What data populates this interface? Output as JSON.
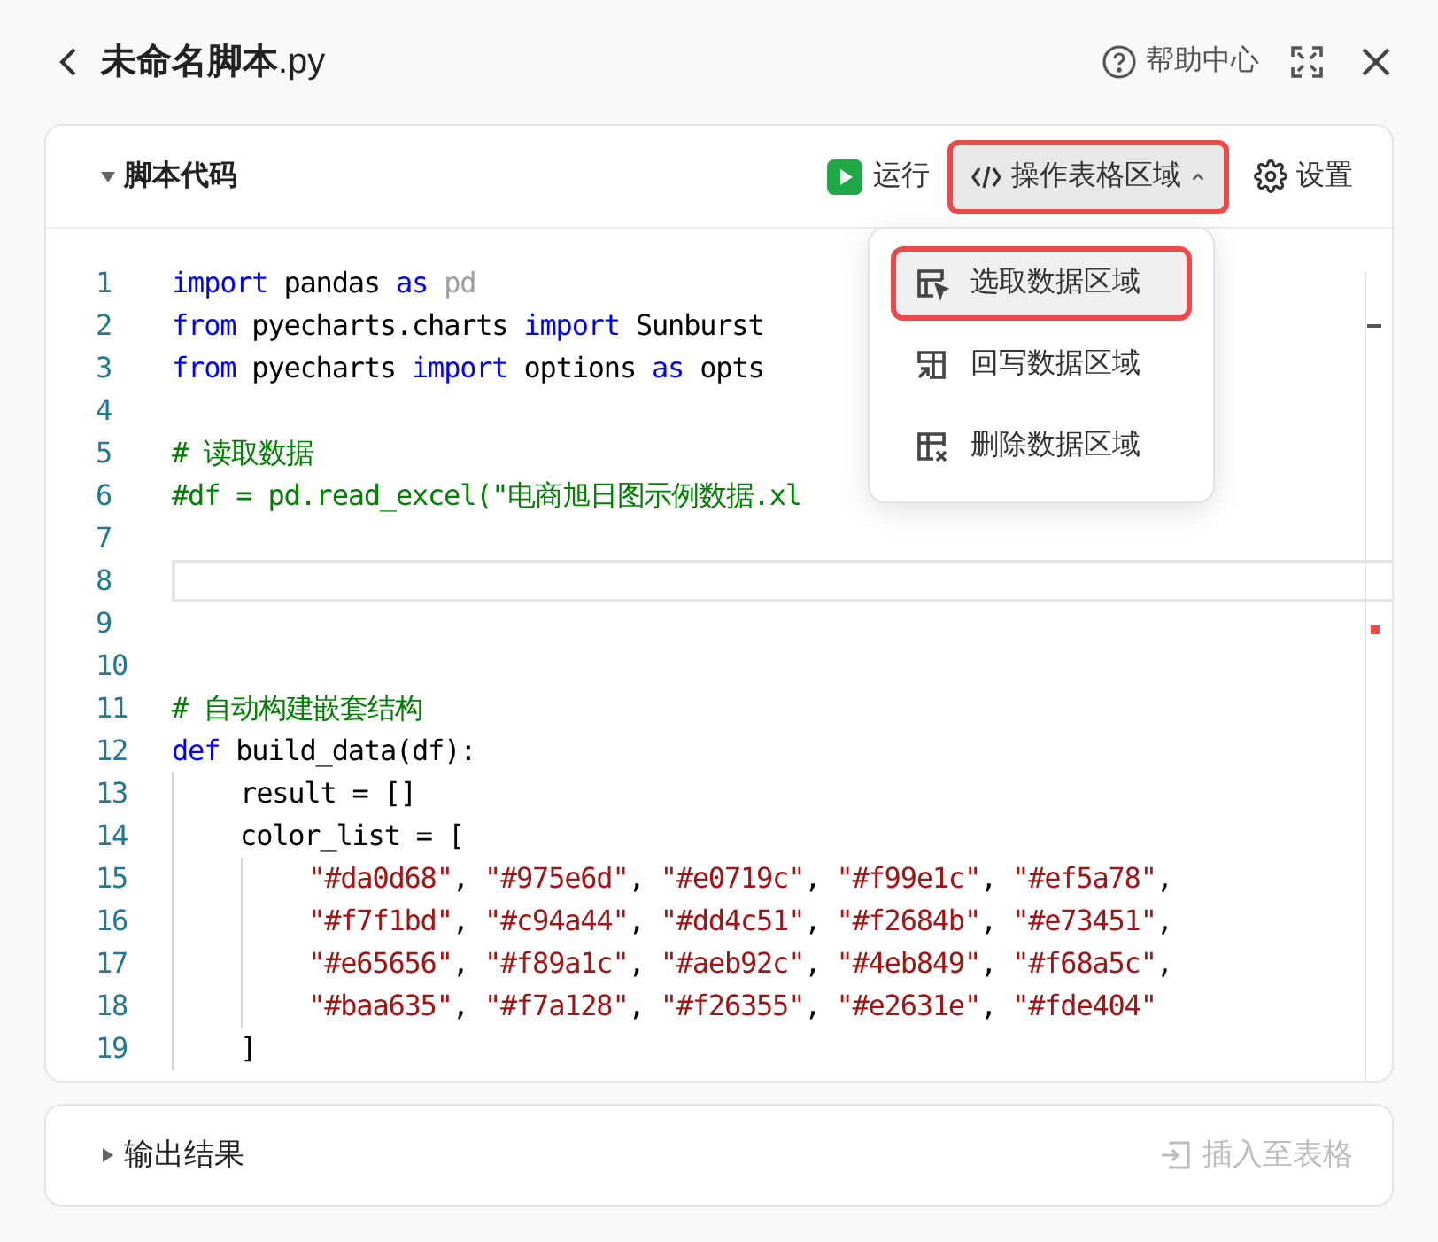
{
  "header": {
    "title_bold": "未命名脚本",
    "title_ext": ".py",
    "help": "帮助中心"
  },
  "script_panel": {
    "title": "脚本代码",
    "expanded": true,
    "run": "运行",
    "operate": {
      "label": "操作表格区域",
      "expanded": true
    },
    "settings": "设置",
    "menu": [
      {
        "label": "选取数据区域",
        "selected": true
      },
      {
        "label": "回写数据区域",
        "selected": false
      },
      {
        "label": "删除数据区域",
        "selected": false
      }
    ],
    "lines": [
      {
        "number": "1",
        "current": false,
        "tokens": [
          {
            "kind": "keyword",
            "text": "import"
          },
          {
            "kind": "plain",
            "text": " pandas "
          },
          {
            "kind": "keyword",
            "text": "as"
          },
          {
            "kind": "dim",
            "text": " pd"
          }
        ]
      },
      {
        "number": "2",
        "current": false,
        "tokens": [
          {
            "kind": "keyword",
            "text": "from"
          },
          {
            "kind": "plain",
            "text": " pyecharts.charts "
          },
          {
            "kind": "keyword",
            "text": "import"
          },
          {
            "kind": "plain",
            "text": " Sunburst"
          }
        ]
      },
      {
        "number": "3",
        "current": false,
        "tokens": [
          {
            "kind": "keyword",
            "text": "from"
          },
          {
            "kind": "plain",
            "text": " pyecharts "
          },
          {
            "kind": "keyword",
            "text": "import"
          },
          {
            "kind": "plain",
            "text": " options "
          },
          {
            "kind": "keyword",
            "text": "as"
          },
          {
            "kind": "plain",
            "text": " opts"
          }
        ]
      },
      {
        "number": "4",
        "current": false
      },
      {
        "number": "5",
        "current": false,
        "tokens": [
          {
            "kind": "comment",
            "text": "# 读取数据"
          }
        ]
      },
      {
        "number": "6",
        "current": false,
        "tokens": [
          {
            "kind": "comment",
            "text": "#df = pd.read_excel(\"电商旭日图示例数据.xl"
          }
        ]
      },
      {
        "number": "7",
        "current": false
      },
      {
        "number": "8",
        "current": true
      },
      {
        "number": "9",
        "current": false
      },
      {
        "number": "10",
        "current": false
      },
      {
        "number": "11",
        "current": false,
        "tokens": [
          {
            "kind": "comment",
            "text": "# 自动构建嵌套结构"
          }
        ]
      },
      {
        "number": "12",
        "current": false,
        "tokens": [
          {
            "kind": "keyword",
            "text": "def"
          },
          {
            "kind": "plain",
            "text": " build_data(df):"
          }
        ],
        "children": [
          {
            "number": "13",
            "current": false,
            "tokens": [
              {
                "kind": "plain",
                "text": "result = []"
              }
            ]
          },
          {
            "number": "14",
            "current": false,
            "tokens": [
              {
                "kind": "plain",
                "text": "color_list = ["
              }
            ],
            "children": [
              {
                "number": "15",
                "current": false,
                "tokens": [
                  {
                    "kind": "string",
                    "text": "\"#da0d68\""
                  },
                  {
                    "kind": "plain",
                    "text": ", "
                  },
                  {
                    "kind": "string",
                    "text": "\"#975e6d\""
                  },
                  {
                    "kind": "plain",
                    "text": ", "
                  },
                  {
                    "kind": "string",
                    "text": "\"#e0719c\""
                  },
                  {
                    "kind": "plain",
                    "text": ", "
                  },
                  {
                    "kind": "string",
                    "text": "\"#f99e1c\""
                  },
                  {
                    "kind": "plain",
                    "text": ", "
                  },
                  {
                    "kind": "string",
                    "text": "\"#ef5a78\""
                  },
                  {
                    "kind": "plain",
                    "text": ","
                  }
                ]
              },
              {
                "number": "16",
                "current": false,
                "tokens": [
                  {
                    "kind": "string",
                    "text": "\"#f7f1bd\""
                  },
                  {
                    "kind": "plain",
                    "text": ", "
                  },
                  {
                    "kind": "string",
                    "text": "\"#c94a44\""
                  },
                  {
                    "kind": "plain",
                    "text": ", "
                  },
                  {
                    "kind": "string",
                    "text": "\"#dd4c51\""
                  },
                  {
                    "kind": "plain",
                    "text": ", "
                  },
                  {
                    "kind": "string",
                    "text": "\"#f2684b\""
                  },
                  {
                    "kind": "plain",
                    "text": ", "
                  },
                  {
                    "kind": "string",
                    "text": "\"#e73451\""
                  },
                  {
                    "kind": "plain",
                    "text": ","
                  }
                ]
              },
              {
                "number": "17",
                "current": false,
                "tokens": [
                  {
                    "kind": "string",
                    "text": "\"#e65656\""
                  },
                  {
                    "kind": "plain",
                    "text": ", "
                  },
                  {
                    "kind": "string",
                    "text": "\"#f89a1c\""
                  },
                  {
                    "kind": "plain",
                    "text": ", "
                  },
                  {
                    "kind": "string",
                    "text": "\"#aeb92c\""
                  },
                  {
                    "kind": "plain",
                    "text": ", "
                  },
                  {
                    "kind": "string",
                    "text": "\"#4eb849\""
                  },
                  {
                    "kind": "plain",
                    "text": ", "
                  },
                  {
                    "kind": "string",
                    "text": "\"#f68a5c\""
                  },
                  {
                    "kind": "plain",
                    "text": ","
                  }
                ]
              },
              {
                "number": "18",
                "current": false,
                "tokens": [
                  {
                    "kind": "string",
                    "text": "\"#baa635\""
                  },
                  {
                    "kind": "plain",
                    "text": ", "
                  },
                  {
                    "kind": "string",
                    "text": "\"#f7a128\""
                  },
                  {
                    "kind": "plain",
                    "text": ", "
                  },
                  {
                    "kind": "string",
                    "text": "\"#f26355\""
                  },
                  {
                    "kind": "plain",
                    "text": ", "
                  },
                  {
                    "kind": "string",
                    "text": "\"#e2631e\""
                  },
                  {
                    "kind": "plain",
                    "text": ", "
                  },
                  {
                    "kind": "string",
                    "text": "\"#fde404\""
                  }
                ]
              }
            ]
          },
          {
            "number": "19",
            "current": false,
            "tokens": [
              {
                "kind": "plain",
                "text": "]"
              }
            ]
          }
        ]
      }
    ]
  },
  "output_panel": {
    "title": "输出结果",
    "expanded": false,
    "insert": {
      "label": "插入至表格",
      "disabled": true
    }
  }
}
